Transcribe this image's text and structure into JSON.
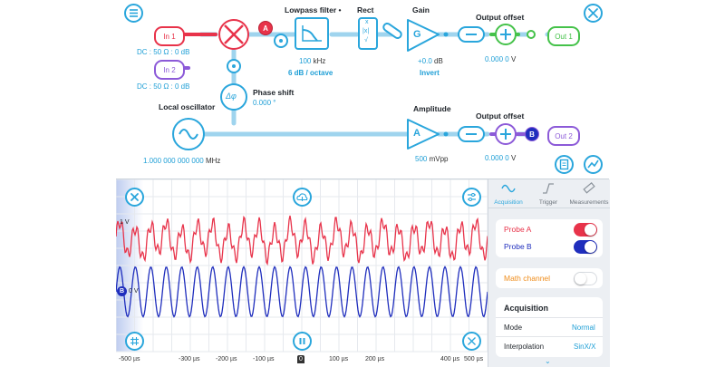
{
  "signal_chain": {
    "inputs": [
      {
        "label": "In 1",
        "coupling": "DC : 50 Ω : 0 dB"
      },
      {
        "label": "In 2",
        "coupling": "DC : 50 Ω : 0 dB"
      }
    ],
    "mixer_badge": "A",
    "lowpass": {
      "title": "Lowpass filter •",
      "value": "100",
      "unit": "kHz",
      "slope": "6 dB / octave"
    },
    "rect": {
      "title": "Rect",
      "glyphs": [
        "x",
        "|x|",
        "√"
      ]
    },
    "gain": {
      "title": "Gain",
      "symbol": "G",
      "value": "+0.0",
      "unit": "dB",
      "mode": "Invert"
    },
    "output_offset_1": {
      "title": "Output offset",
      "value": "0.000 0",
      "unit": "V",
      "output": "Out 1"
    },
    "phase_shift": {
      "title": "Phase shift",
      "symbol": "Δφ",
      "value": "0.000 °"
    },
    "local_oscillator": {
      "title": "Local oscillator",
      "value": "1.000 000 000 000",
      "unit": "MHz"
    },
    "amplitude": {
      "title": "Amplitude",
      "symbol": "A",
      "value": "500",
      "unit": "mVpp"
    },
    "output_offset_2": {
      "title": "Output offset",
      "value": "0.000 0",
      "unit": "V",
      "output": "Out 2",
      "badge": "B"
    }
  },
  "scope": {
    "marker_a": "1 V",
    "marker_b_label": "B",
    "marker_b_value": "0 V",
    "x_ticks": [
      "-500 µs",
      "-300 µs",
      "-200 µs",
      "-100 µs",
      "0",
      "100 µs",
      "200 µs",
      "400 µs",
      "500 µs"
    ],
    "probe_a": {
      "amplitude_V": 0.15,
      "color": "#e8334a"
    },
    "probe_b": {
      "amplitude_V": 0.25,
      "color": "#1f2ebd"
    }
  },
  "panel": {
    "tabs": [
      {
        "label": "Acquisition",
        "icon": "sine-wave-icon",
        "active": true
      },
      {
        "label": "Trigger",
        "icon": "trigger-step-icon",
        "active": false
      },
      {
        "label": "Measurements",
        "icon": "ruler-icon",
        "active": false
      }
    ],
    "probe_a": {
      "label": "Probe A",
      "on": true,
      "color": "#e8334a"
    },
    "probe_b": {
      "label": "Probe B",
      "on": true,
      "color": "#1f2ebd"
    },
    "math": {
      "label": "Math channel",
      "on": false,
      "color": "#ef8c1a"
    },
    "acquisition": {
      "title": "Acquisition",
      "rows": [
        {
          "label": "Mode",
          "value": "Normal"
        },
        {
          "label": "Interpolation",
          "value": "SinX/X"
        }
      ]
    }
  },
  "colors": {
    "accent": "#2aa6dc",
    "red": "#e8334a",
    "purple": "#8c5ad8",
    "green": "#45c24a"
  }
}
